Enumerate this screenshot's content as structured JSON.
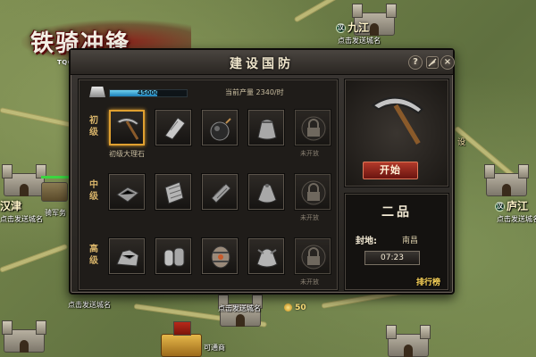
{
  "logo": {
    "title": "铁骑冲锋",
    "url": "TQCF.MENLE.COM"
  },
  "map": {
    "cities": [
      {
        "name": "九江",
        "flag": "汉"
      },
      {
        "name": "庐江",
        "flag": "汉"
      },
      {
        "name": "汉津",
        "flag": ""
      }
    ],
    "labels": {
      "send_city_name": "点击发送城名",
      "army": "骑军务",
      "trade": "可通商",
      "gold": "50",
      "side_char": "设"
    }
  },
  "dialog": {
    "title": "建设国防",
    "help_label": "?",
    "close_label": "×",
    "production": {
      "progress_text": "45000",
      "progress": 0.62,
      "current_label": "当前产量",
      "rate": "2340/时"
    },
    "tiers": [
      {
        "label": "初级",
        "items": [
          {
            "name": "pickaxe-icon",
            "caption": "初级大理石",
            "selected": true
          },
          {
            "name": "iron-plate-icon",
            "caption": ""
          },
          {
            "name": "bomb-icon",
            "caption": ""
          },
          {
            "name": "sack-icon",
            "caption": ""
          },
          {
            "name": "lock-icon",
            "caption": "未开放",
            "locked": true
          }
        ]
      },
      {
        "label": "中级",
        "items": [
          {
            "name": "chest-icon",
            "caption": ""
          },
          {
            "name": "scroll-icon",
            "caption": ""
          },
          {
            "name": "log-bundle-icon",
            "caption": ""
          },
          {
            "name": "pouch-icon",
            "caption": ""
          },
          {
            "name": "lock-icon",
            "caption": "未开放",
            "locked": true
          }
        ]
      },
      {
        "label": "高级",
        "items": [
          {
            "name": "ore-pile-icon",
            "caption": ""
          },
          {
            "name": "scroll-bundle-icon",
            "caption": ""
          },
          {
            "name": "barrel-icon",
            "caption": ""
          },
          {
            "name": "treasure-bag-icon",
            "caption": ""
          },
          {
            "name": "lock-icon",
            "caption": "未开放",
            "locked": true
          }
        ]
      }
    ],
    "preview": {
      "icon": "pickaxe-icon",
      "start_label": "开始"
    },
    "info": {
      "rank": "二品",
      "fief_label": "封地:",
      "fief_value": "南昌",
      "timer": "07:23",
      "leaderboard_label": "排行榜"
    }
  }
}
